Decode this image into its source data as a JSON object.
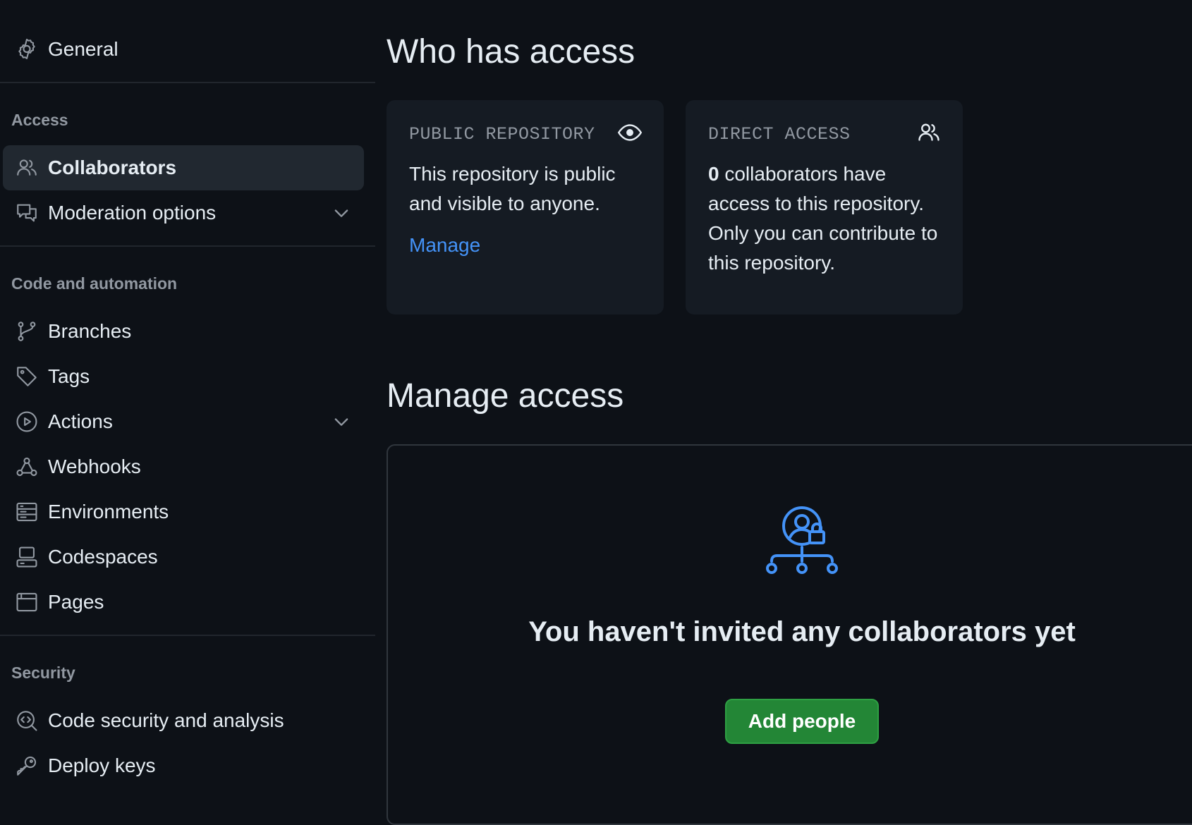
{
  "sidebar": {
    "general_label": "General",
    "sections": {
      "access": "Access",
      "code_automation": "Code and automation",
      "security": "Security"
    },
    "items": {
      "collaborators": "Collaborators",
      "moderation": "Moderation options",
      "branches": "Branches",
      "tags": "Tags",
      "actions": "Actions",
      "webhooks": "Webhooks",
      "environments": "Environments",
      "codespaces": "Codespaces",
      "pages": "Pages",
      "code_security": "Code security and analysis",
      "deploy_keys": "Deploy keys"
    },
    "active_item": "Collaborators",
    "expandable_items": [
      "Moderation options",
      "Actions"
    ]
  },
  "main": {
    "who_has_access_title": "Who has access",
    "public_card": {
      "heading": "PUBLIC REPOSITORY",
      "text": "This repository is public and visible to anyone.",
      "link": "Manage",
      "icon": "eye-icon"
    },
    "direct_card": {
      "heading": "DIRECT ACCESS",
      "count": "0",
      "text": " collaborators have access to this repository. Only you can contribute to this repository.",
      "icon": "people-icon"
    },
    "manage_access_title": "Manage access",
    "empty_state": {
      "title": "You haven't invited any collaborators yet",
      "button": "Add people",
      "icon": "person-lock-network-icon"
    }
  },
  "colors": {
    "background": "#0d1117",
    "card_background": "#151b23",
    "active_nav": "#212830",
    "link": "#4493f8",
    "primary_button": "#238636",
    "muted_text": "#9198a1"
  }
}
